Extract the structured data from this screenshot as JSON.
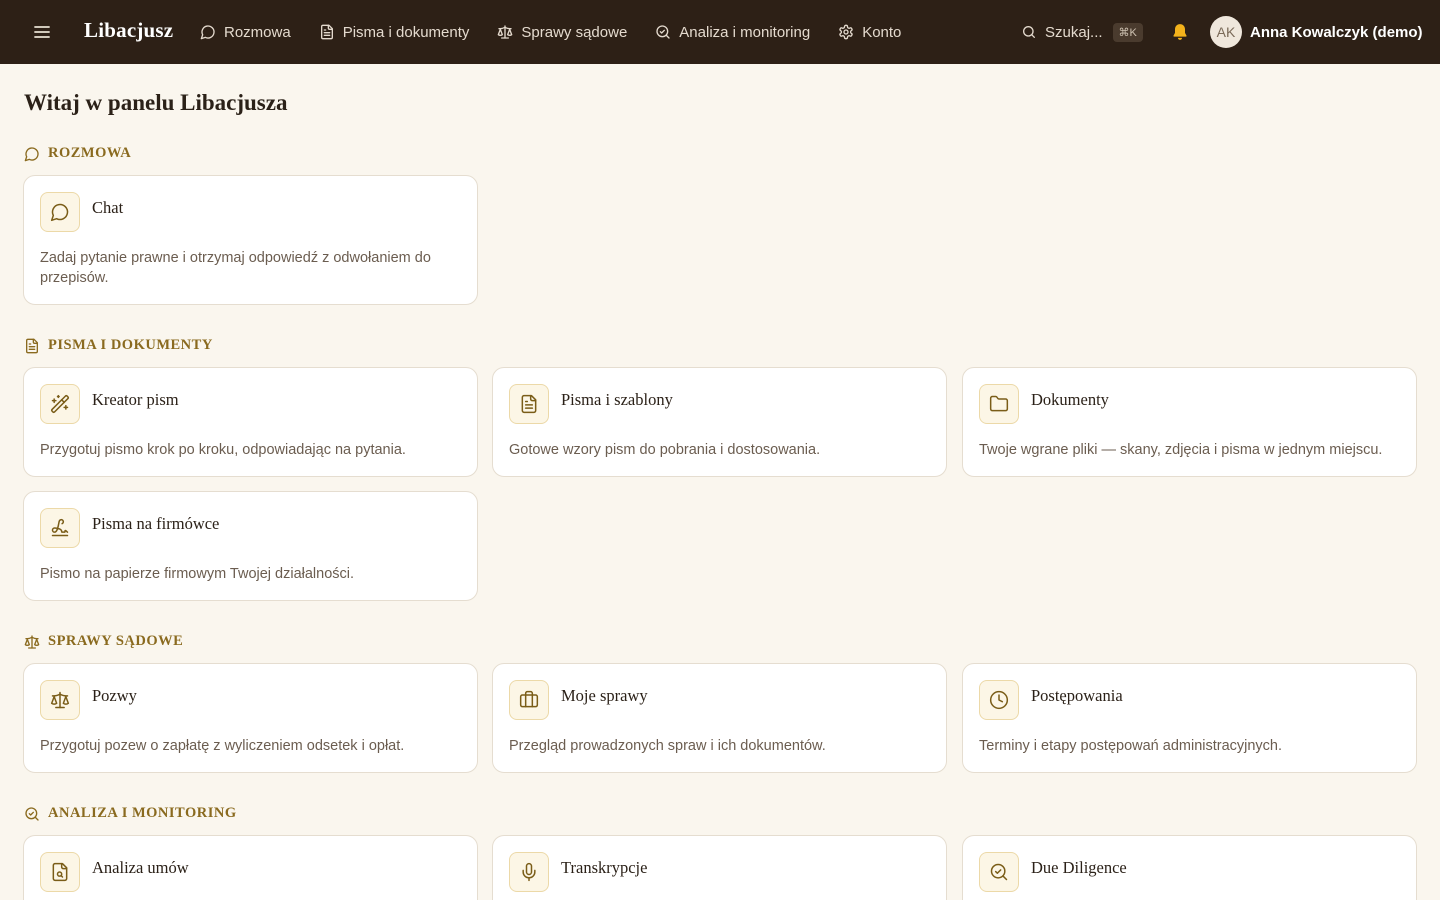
{
  "app": {
    "brand": "Libacjusz"
  },
  "nav": [
    {
      "label": "Rozmowa",
      "icon": "chat-icon"
    },
    {
      "label": "Pisma i dokumenty",
      "icon": "document-icon"
    },
    {
      "label": "Sprawy sądowe",
      "icon": "scales-icon"
    },
    {
      "label": "Analiza i monitoring",
      "icon": "search-scan-icon"
    },
    {
      "label": "Konto",
      "icon": "gear-icon"
    }
  ],
  "search": {
    "label": "Szukaj...",
    "shortcut": "⌘K"
  },
  "user": {
    "initials": "AK",
    "name": "Anna Kowalczyk (demo)"
  },
  "page": {
    "title": "Witaj w panelu Libacjusza"
  },
  "sections": {
    "rozmowa": {
      "title": "Rozmowa",
      "cards": [
        {
          "title": "Chat",
          "desc": "Zadaj pytanie prawne i otrzymaj odpowiedź z odwołaniem do przepisów.",
          "icon": "chat-icon"
        }
      ]
    },
    "pisma": {
      "title": "Pisma i dokumenty",
      "cards": [
        {
          "title": "Kreator pism",
          "desc": "Przygotuj pismo krok po kroku, odpowiadając na pytania.",
          "icon": "magic-wand-icon"
        },
        {
          "title": "Pisma i szablony",
          "desc": "Gotowe wzory pism do pobrania i dostosowania.",
          "icon": "document-icon"
        },
        {
          "title": "Dokumenty",
          "desc": "Twoje wgrane pliki — skany, zdjęcia i pisma w jednym miejscu.",
          "icon": "folder-icon"
        },
        {
          "title": "Pisma na firmówce",
          "desc": "Pismo na papierze firmowym Twojej działalności.",
          "icon": "signature-icon"
        }
      ]
    },
    "sprawy": {
      "title": "Sprawy sądowe",
      "cards": [
        {
          "title": "Pozwy",
          "desc": "Przygotuj pozew o zapłatę z wyliczeniem odsetek i opłat.",
          "icon": "scales-icon"
        },
        {
          "title": "Moje sprawy",
          "desc": "Przegląd prowadzonych spraw i ich dokumentów.",
          "icon": "briefcase-icon"
        },
        {
          "title": "Postępowania",
          "desc": "Terminy i etapy postępowań administracyjnych.",
          "icon": "clock-icon"
        }
      ]
    },
    "analiza": {
      "title": "Analiza i monitoring",
      "cards": [
        {
          "title": "Analiza umów",
          "icon": "file-search-icon"
        },
        {
          "title": "Transkrypcje",
          "icon": "microphone-icon"
        },
        {
          "title": "Due Diligence",
          "icon": "search-scan-icon"
        }
      ]
    }
  },
  "colors": {
    "topbar": "#2d2016",
    "background": "#faf6ee",
    "accent": "#8a6a1f",
    "icon_tile": "#fcf6e6"
  }
}
